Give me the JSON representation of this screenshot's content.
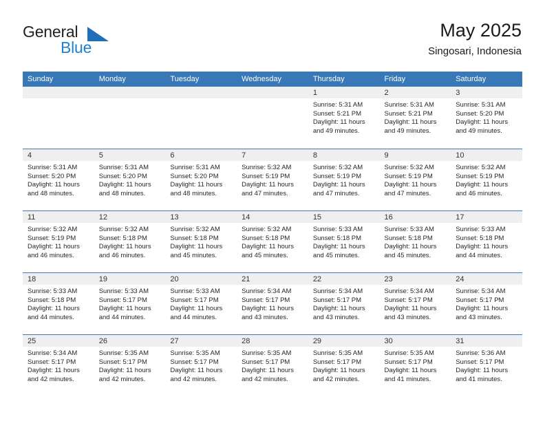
{
  "brand": {
    "name_part1": "General",
    "name_part2": "Blue",
    "logo_icon": "triangle-logo-icon",
    "accent_color": "#1f7fd0"
  },
  "header": {
    "title": "May 2025",
    "location": "Singosari, Indonesia"
  },
  "theme": {
    "header_bar_color": "#3878b6",
    "day_number_band_color": "#efefef",
    "text_color": "#262626"
  },
  "calendar": {
    "weekdays": [
      "Sunday",
      "Monday",
      "Tuesday",
      "Wednesday",
      "Thursday",
      "Friday",
      "Saturday"
    ],
    "weeks": [
      [
        {
          "day": "",
          "empty": true
        },
        {
          "day": "",
          "empty": true
        },
        {
          "day": "",
          "empty": true
        },
        {
          "day": "",
          "empty": true
        },
        {
          "day": "1",
          "sunrise": "Sunrise: 5:31 AM",
          "sunset": "Sunset: 5:21 PM",
          "daylight": "Daylight: 11 hours and 49 minutes."
        },
        {
          "day": "2",
          "sunrise": "Sunrise: 5:31 AM",
          "sunset": "Sunset: 5:21 PM",
          "daylight": "Daylight: 11 hours and 49 minutes."
        },
        {
          "day": "3",
          "sunrise": "Sunrise: 5:31 AM",
          "sunset": "Sunset: 5:20 PM",
          "daylight": "Daylight: 11 hours and 49 minutes."
        }
      ],
      [
        {
          "day": "4",
          "sunrise": "Sunrise: 5:31 AM",
          "sunset": "Sunset: 5:20 PM",
          "daylight": "Daylight: 11 hours and 48 minutes."
        },
        {
          "day": "5",
          "sunrise": "Sunrise: 5:31 AM",
          "sunset": "Sunset: 5:20 PM",
          "daylight": "Daylight: 11 hours and 48 minutes."
        },
        {
          "day": "6",
          "sunrise": "Sunrise: 5:31 AM",
          "sunset": "Sunset: 5:20 PM",
          "daylight": "Daylight: 11 hours and 48 minutes."
        },
        {
          "day": "7",
          "sunrise": "Sunrise: 5:32 AM",
          "sunset": "Sunset: 5:19 PM",
          "daylight": "Daylight: 11 hours and 47 minutes."
        },
        {
          "day": "8",
          "sunrise": "Sunrise: 5:32 AM",
          "sunset": "Sunset: 5:19 PM",
          "daylight": "Daylight: 11 hours and 47 minutes."
        },
        {
          "day": "9",
          "sunrise": "Sunrise: 5:32 AM",
          "sunset": "Sunset: 5:19 PM",
          "daylight": "Daylight: 11 hours and 47 minutes."
        },
        {
          "day": "10",
          "sunrise": "Sunrise: 5:32 AM",
          "sunset": "Sunset: 5:19 PM",
          "daylight": "Daylight: 11 hours and 46 minutes."
        }
      ],
      [
        {
          "day": "11",
          "sunrise": "Sunrise: 5:32 AM",
          "sunset": "Sunset: 5:19 PM",
          "daylight": "Daylight: 11 hours and 46 minutes."
        },
        {
          "day": "12",
          "sunrise": "Sunrise: 5:32 AM",
          "sunset": "Sunset: 5:18 PM",
          "daylight": "Daylight: 11 hours and 46 minutes."
        },
        {
          "day": "13",
          "sunrise": "Sunrise: 5:32 AM",
          "sunset": "Sunset: 5:18 PM",
          "daylight": "Daylight: 11 hours and 45 minutes."
        },
        {
          "day": "14",
          "sunrise": "Sunrise: 5:32 AM",
          "sunset": "Sunset: 5:18 PM",
          "daylight": "Daylight: 11 hours and 45 minutes."
        },
        {
          "day": "15",
          "sunrise": "Sunrise: 5:33 AM",
          "sunset": "Sunset: 5:18 PM",
          "daylight": "Daylight: 11 hours and 45 minutes."
        },
        {
          "day": "16",
          "sunrise": "Sunrise: 5:33 AM",
          "sunset": "Sunset: 5:18 PM",
          "daylight": "Daylight: 11 hours and 45 minutes."
        },
        {
          "day": "17",
          "sunrise": "Sunrise: 5:33 AM",
          "sunset": "Sunset: 5:18 PM",
          "daylight": "Daylight: 11 hours and 44 minutes."
        }
      ],
      [
        {
          "day": "18",
          "sunrise": "Sunrise: 5:33 AM",
          "sunset": "Sunset: 5:18 PM",
          "daylight": "Daylight: 11 hours and 44 minutes."
        },
        {
          "day": "19",
          "sunrise": "Sunrise: 5:33 AM",
          "sunset": "Sunset: 5:17 PM",
          "daylight": "Daylight: 11 hours and 44 minutes."
        },
        {
          "day": "20",
          "sunrise": "Sunrise: 5:33 AM",
          "sunset": "Sunset: 5:17 PM",
          "daylight": "Daylight: 11 hours and 44 minutes."
        },
        {
          "day": "21",
          "sunrise": "Sunrise: 5:34 AM",
          "sunset": "Sunset: 5:17 PM",
          "daylight": "Daylight: 11 hours and 43 minutes."
        },
        {
          "day": "22",
          "sunrise": "Sunrise: 5:34 AM",
          "sunset": "Sunset: 5:17 PM",
          "daylight": "Daylight: 11 hours and 43 minutes."
        },
        {
          "day": "23",
          "sunrise": "Sunrise: 5:34 AM",
          "sunset": "Sunset: 5:17 PM",
          "daylight": "Daylight: 11 hours and 43 minutes."
        },
        {
          "day": "24",
          "sunrise": "Sunrise: 5:34 AM",
          "sunset": "Sunset: 5:17 PM",
          "daylight": "Daylight: 11 hours and 43 minutes."
        }
      ],
      [
        {
          "day": "25",
          "sunrise": "Sunrise: 5:34 AM",
          "sunset": "Sunset: 5:17 PM",
          "daylight": "Daylight: 11 hours and 42 minutes."
        },
        {
          "day": "26",
          "sunrise": "Sunrise: 5:35 AM",
          "sunset": "Sunset: 5:17 PM",
          "daylight": "Daylight: 11 hours and 42 minutes."
        },
        {
          "day": "27",
          "sunrise": "Sunrise: 5:35 AM",
          "sunset": "Sunset: 5:17 PM",
          "daylight": "Daylight: 11 hours and 42 minutes."
        },
        {
          "day": "28",
          "sunrise": "Sunrise: 5:35 AM",
          "sunset": "Sunset: 5:17 PM",
          "daylight": "Daylight: 11 hours and 42 minutes."
        },
        {
          "day": "29",
          "sunrise": "Sunrise: 5:35 AM",
          "sunset": "Sunset: 5:17 PM",
          "daylight": "Daylight: 11 hours and 42 minutes."
        },
        {
          "day": "30",
          "sunrise": "Sunrise: 5:35 AM",
          "sunset": "Sunset: 5:17 PM",
          "daylight": "Daylight: 11 hours and 41 minutes."
        },
        {
          "day": "31",
          "sunrise": "Sunrise: 5:36 AM",
          "sunset": "Sunset: 5:17 PM",
          "daylight": "Daylight: 11 hours and 41 minutes."
        }
      ]
    ]
  }
}
